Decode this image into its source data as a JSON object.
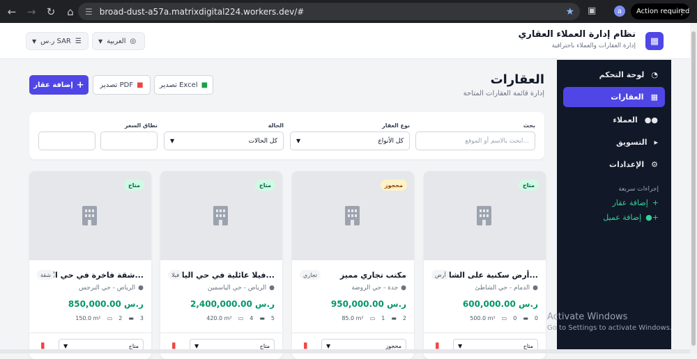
{
  "browser": {
    "url": "broad-dust-a57a.matrixdigital224.workers.dev/#",
    "profile_initial": "a",
    "action_required": "Action required",
    "icons": [
      "back-icon",
      "forward-icon",
      "reload-icon",
      "home-icon",
      "tune-icon",
      "star-icon",
      "extensions-icon",
      "menu-dots-icon"
    ]
  },
  "header": {
    "title": "نظام إدارة العملاء العقاري",
    "subtitle": "إدارة العقارات والعملاء باحترافية",
    "language": "العربية",
    "currency": "ر.س SAR"
  },
  "sidebar": {
    "items": [
      {
        "label": "لوحة التحكم",
        "icon": "chart-pie-icon"
      },
      {
        "label": "العقارات",
        "icon": "building-icon",
        "active": true
      },
      {
        "label": "العملاء",
        "icon": "users-icon"
      },
      {
        "label": "التسويق",
        "icon": "megaphone-icon"
      },
      {
        "label": "الإعدادات",
        "icon": "gear-icon"
      }
    ],
    "quick_title": "إجراءات سريعة",
    "quick_links": [
      {
        "label": "إضافة عقار",
        "icon": "plus-icon"
      },
      {
        "label": "إضافة عميل",
        "icon": "user-plus-icon"
      }
    ]
  },
  "page": {
    "title": "العقارات",
    "subtitle": "إدارة قائمة العقارات المتاحة",
    "export_excel": "تصدير Excel",
    "export_pdf": "تصدير PDF",
    "add_property": "إضافة عقار"
  },
  "filters": {
    "search_label": "بحث",
    "search_placeholder": "ابحث بالاسم أو الموقع...",
    "type_label": "نوع العقار",
    "type_value": "كل الأنواع",
    "status_label": "الحالة",
    "status_value": "كل الحالات",
    "price_label": "نطاق السعر"
  },
  "colors": {
    "primary": "#4f46e5",
    "sidebar": "#111827",
    "price": "#059669",
    "available_bg": "#d1fae5",
    "available_fg": "#065f46",
    "reserved_bg": "#fef3c7",
    "reserved_fg": "#92400e"
  },
  "properties": [
    {
      "status": "متاح",
      "status_kind": "available",
      "title": "أرض سكنية على الشا...",
      "type": "أرض",
      "location": "الدمام - حي الشاطئ",
      "price": "600,000.00 ر.س",
      "beds": "0",
      "baths": "0",
      "area": "500.0 m²",
      "select": "متاح"
    },
    {
      "status": "محجوز",
      "status_kind": "reserved",
      "title": "مكتب تجاري مميز",
      "type": "تجاري",
      "location": "جدة - حي الروضة",
      "price": "950,000.00 ر.س",
      "beds": "2",
      "baths": "1",
      "area": "85.0 m²",
      "select": "محجوز"
    },
    {
      "status": "متاح",
      "status_kind": "available",
      "title": "فيلا عائلية في حي اليا...",
      "type": "فيلا",
      "location": "الرياض - حي الياسمين",
      "price": "2,400,000.00 ر.س",
      "beds": "5",
      "baths": "4",
      "area": "420.0 m²",
      "select": "متاح"
    },
    {
      "status": "متاح",
      "status_kind": "available",
      "title": "شقة فاخرة في حي الن...",
      "type": "شقة",
      "location": "الرياض - حي النرجس",
      "price": "850,000.00 ر.س",
      "beds": "3",
      "baths": "2",
      "area": "150.0 m²",
      "select": "متاح"
    }
  ],
  "watermark": {
    "line1": "Activate Windows",
    "line2": "Go to Settings to activate Windows."
  }
}
